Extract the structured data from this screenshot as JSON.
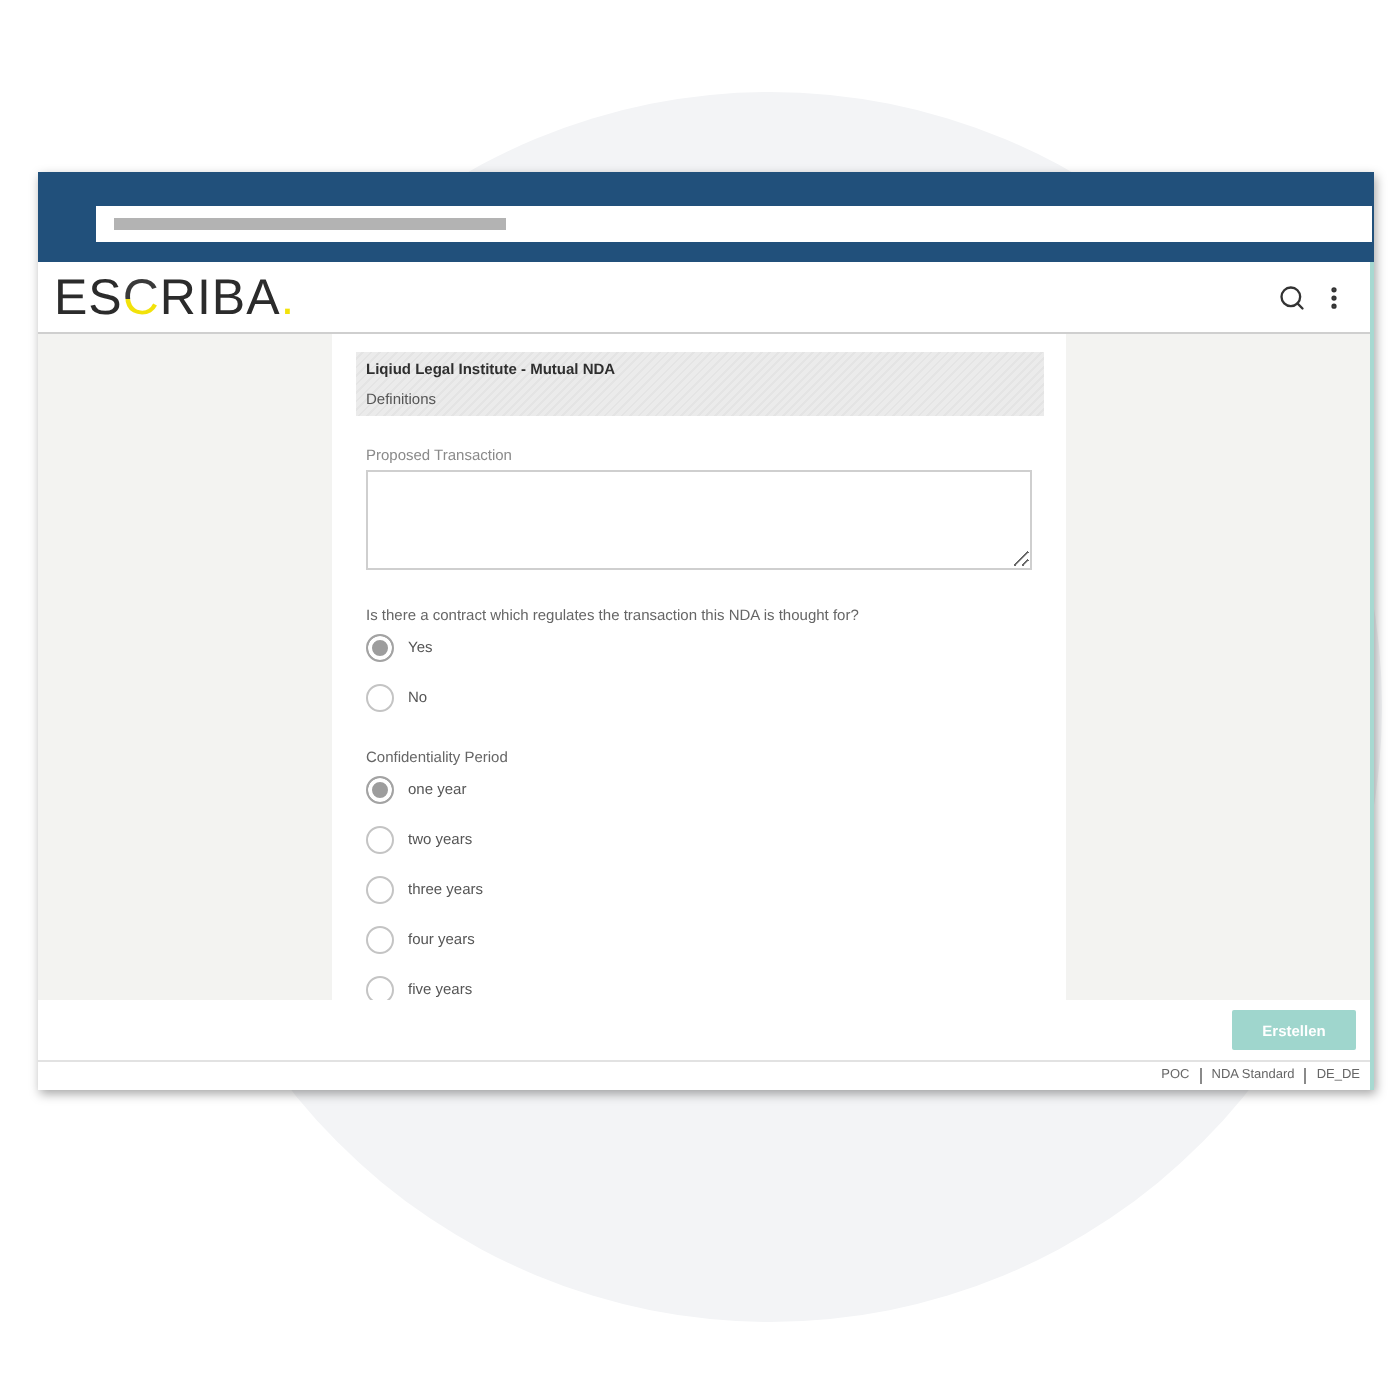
{
  "app": {
    "logo": [
      {
        "text": "ES",
        "accent": false
      },
      {
        "text": "C",
        "accent": true
      },
      {
        "text": "RIBA",
        "accent": false
      },
      {
        "text": ".",
        "accent": true
      }
    ]
  },
  "form": {
    "title": "Liqiud Legal Institute - Mutual NDA",
    "section": "Definitions",
    "fields": [
      {
        "kind": "textarea",
        "label": "Proposed Transaction"
      },
      {
        "kind": "radio",
        "label": "Is there a contract which regulates the transaction this NDA is thought for?",
        "options": [
          {
            "label": "Yes",
            "selected": true
          },
          {
            "label": "No",
            "selected": false
          }
        ]
      },
      {
        "kind": "radio",
        "label": "Confidentiality Period",
        "options": [
          {
            "label": "one year",
            "selected": true
          },
          {
            "label": "two years",
            "selected": false
          },
          {
            "label": "three years",
            "selected": false
          },
          {
            "label": "four years",
            "selected": false
          },
          {
            "label": "five years",
            "selected": false
          }
        ]
      }
    ]
  },
  "footer": {
    "button": "Erstellen"
  },
  "status_bar": [
    "POC",
    "NDA Standard",
    "DE_DE"
  ]
}
